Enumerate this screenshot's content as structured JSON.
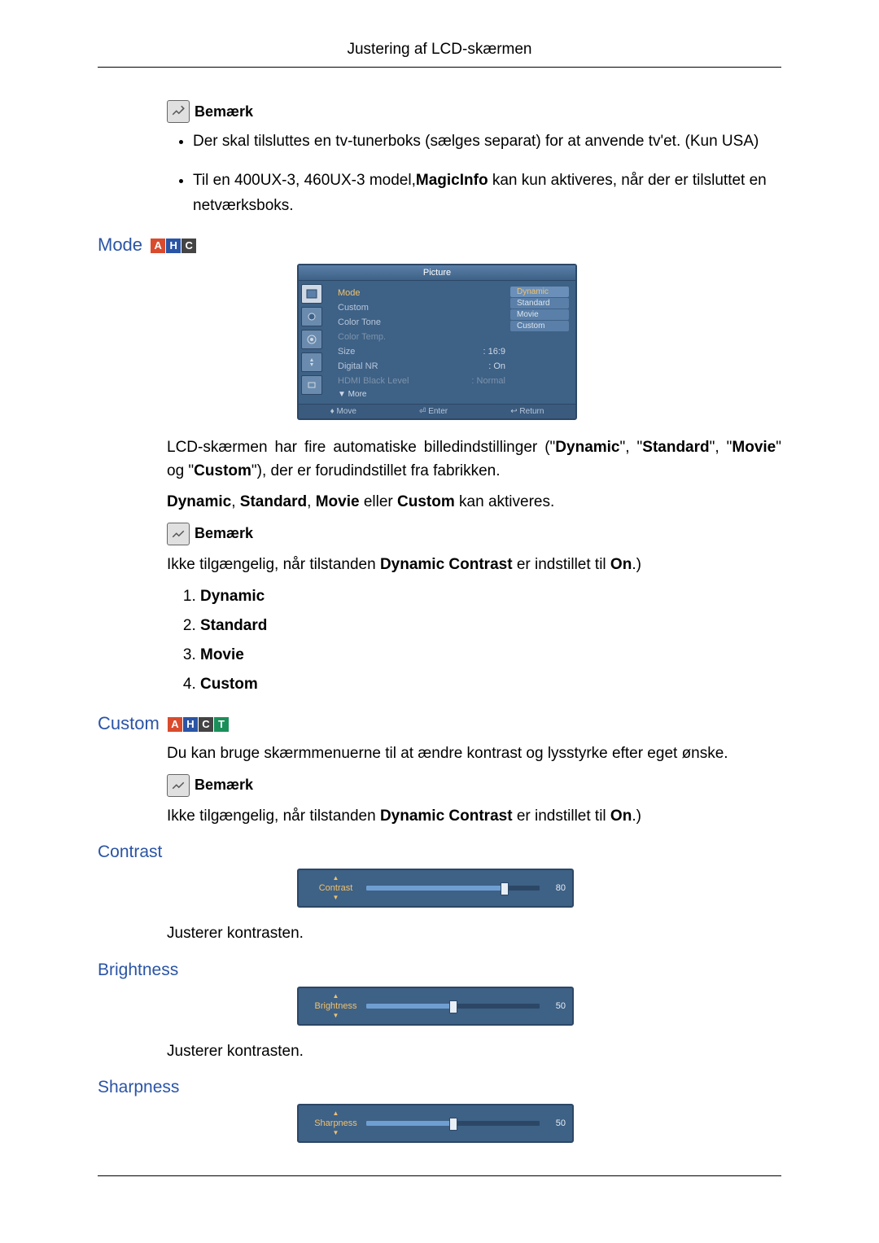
{
  "header": "Justering af LCD-skærmen",
  "note_label": "Bemærk",
  "intro_bullets": [
    "Der skal tilsluttes en tv-tunerboks (sælges separat) for at anvende tv'et. (Kun USA)",
    {
      "pre": "Til en 400UX-3, 460UX-3 model,",
      "bold": "MagicInfo",
      "post": " kan kun aktiveres, når der er tilsluttet en netværksboks."
    }
  ],
  "mode": {
    "title": "Mode",
    "badges": [
      "A",
      "H",
      "C"
    ],
    "osd": {
      "title": "Picture",
      "rows": [
        {
          "label": "Mode",
          "highlight": true
        },
        {
          "label": "Custom"
        },
        {
          "label": "Color Tone",
          "colon": ":"
        },
        {
          "label": "Color Temp.",
          "dim": true
        },
        {
          "label": "Size",
          "val": "16:9",
          "colon": ": "
        },
        {
          "label": "Digital NR",
          "val": "On",
          "colon": ": "
        },
        {
          "label": "HDMI Black Level",
          "val": "Normal",
          "colon": ": ",
          "dim": true
        }
      ],
      "options": [
        "Dynamic",
        "Standard",
        "Movie",
        "Custom"
      ],
      "selectedOption": 0,
      "more": "▼ More",
      "foot": [
        "Move",
        "Enter",
        "Return"
      ],
      "footIcons": [
        "♦",
        "⏎",
        "↩"
      ]
    },
    "para1_pre": "LCD-skærmen har fire automatiske billedindstillinger (\"",
    "para1_b1": "Dynamic",
    "para1_m1": "\", \"",
    "para1_b2": "Standard",
    "para1_m2": "\", \"",
    "para1_b3": "Movie",
    "para1_m3": "\" og \"",
    "para1_b4": "Custom",
    "para1_post": "\"), der er forudindstillet fra fabrikken.",
    "para2_b1": "Dynamic",
    "para2_m1": ", ",
    "para2_b2": "Standard",
    "para2_m2": ", ",
    "para2_b3": "Movie",
    "para2_m3": " eller ",
    "para2_b4": "Custom",
    "para2_post": " kan aktiveres.",
    "note2_pre": "Ikke tilgængelig, når tilstanden ",
    "note2_b": "Dynamic Contrast",
    "note2_m": " er indstillet til ",
    "note2_b2": "On",
    "note2_post": ".)",
    "list": [
      "Dynamic",
      "Standard",
      "Movie",
      "Custom"
    ]
  },
  "custom": {
    "title": "Custom",
    "badges": [
      "A",
      "H",
      "C",
      "T"
    ],
    "para": "Du kan bruge skærmmenuerne til at ændre kontrast og lysstyrke efter eget ønske.",
    "note_pre": "Ikke tilgængelig, når tilstanden ",
    "note_b": "Dynamic Contrast",
    "note_m": " er indstillet til ",
    "note_b2": "On",
    "note_post": ".)"
  },
  "contrast": {
    "title": "Contrast",
    "slider_label": "Contrast",
    "value": 80,
    "desc": "Justerer kontrasten."
  },
  "brightness": {
    "title": "Brightness",
    "slider_label": "Brightness",
    "value": 50,
    "desc": "Justerer kontrasten."
  },
  "sharpness": {
    "title": "Sharpness",
    "slider_label": "Sharpness",
    "value": 50
  }
}
